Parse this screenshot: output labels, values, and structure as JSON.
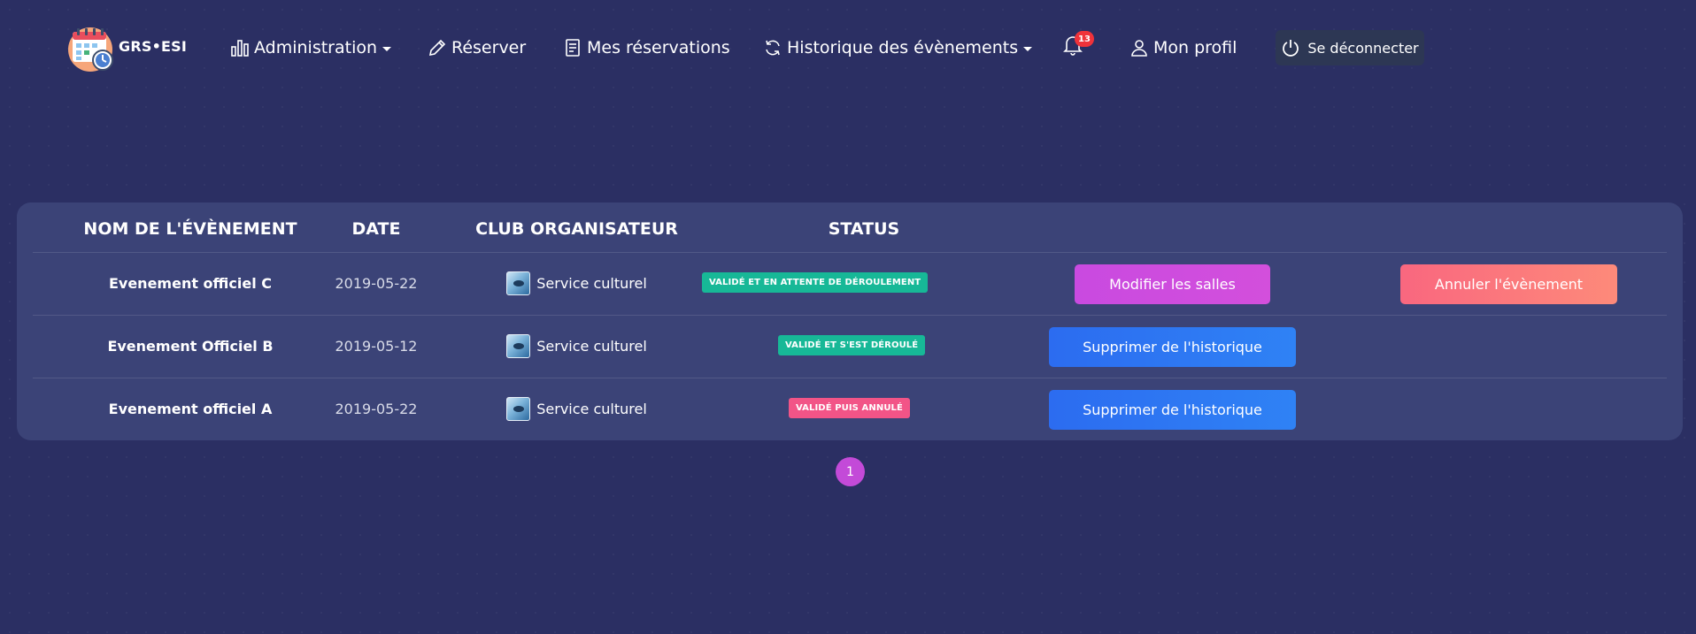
{
  "brand": {
    "name": "GRS•ESI"
  },
  "nav": {
    "administration": "Administration",
    "reserver": "Réserver",
    "mes_reservations": "Mes réservations",
    "historique": "Historique des évènements",
    "notifications_count": "13",
    "mon_profil": "Mon profil",
    "logout": "Se déconnecter"
  },
  "table": {
    "headers": [
      "NOM DE L'ÉVÈNEMENT",
      "DATE",
      "CLUB ORGANISATEUR",
      "STATUS"
    ],
    "rows": [
      {
        "name": "Evenement officiel C",
        "date": "2019-05-22",
        "club": "Service culturel",
        "status": "VALIDÉ ET EN ATTENTE DE DÉROULEMENT",
        "status_color": "#17b897",
        "action1": "Modifier les salles",
        "action2": "Annuler l'évènement"
      },
      {
        "name": "Evenement Officiel B",
        "date": "2019-05-12",
        "club": "Service culturel",
        "status": "VALIDÉ ET S'EST DÉROULÉ",
        "status_color": "#17b897",
        "action1": "Supprimer de l'historique"
      },
      {
        "name": "Evenement officiel A",
        "date": "2019-05-22",
        "club": "Service culturel",
        "status": "VALIDÉ PUIS ANNULÉ",
        "status_color": "#f25487",
        "action1": "Supprimer de l'historique"
      }
    ]
  },
  "pagination": {
    "current": "1"
  },
  "colors": {
    "background": "#2b2f63",
    "card": "#3b4377",
    "accent_purple": "#c94ae0",
    "accent_blue": "#2c6cf0",
    "accent_coral": "#f9677f",
    "badge_green": "#17b897",
    "badge_pink": "#f25487"
  }
}
